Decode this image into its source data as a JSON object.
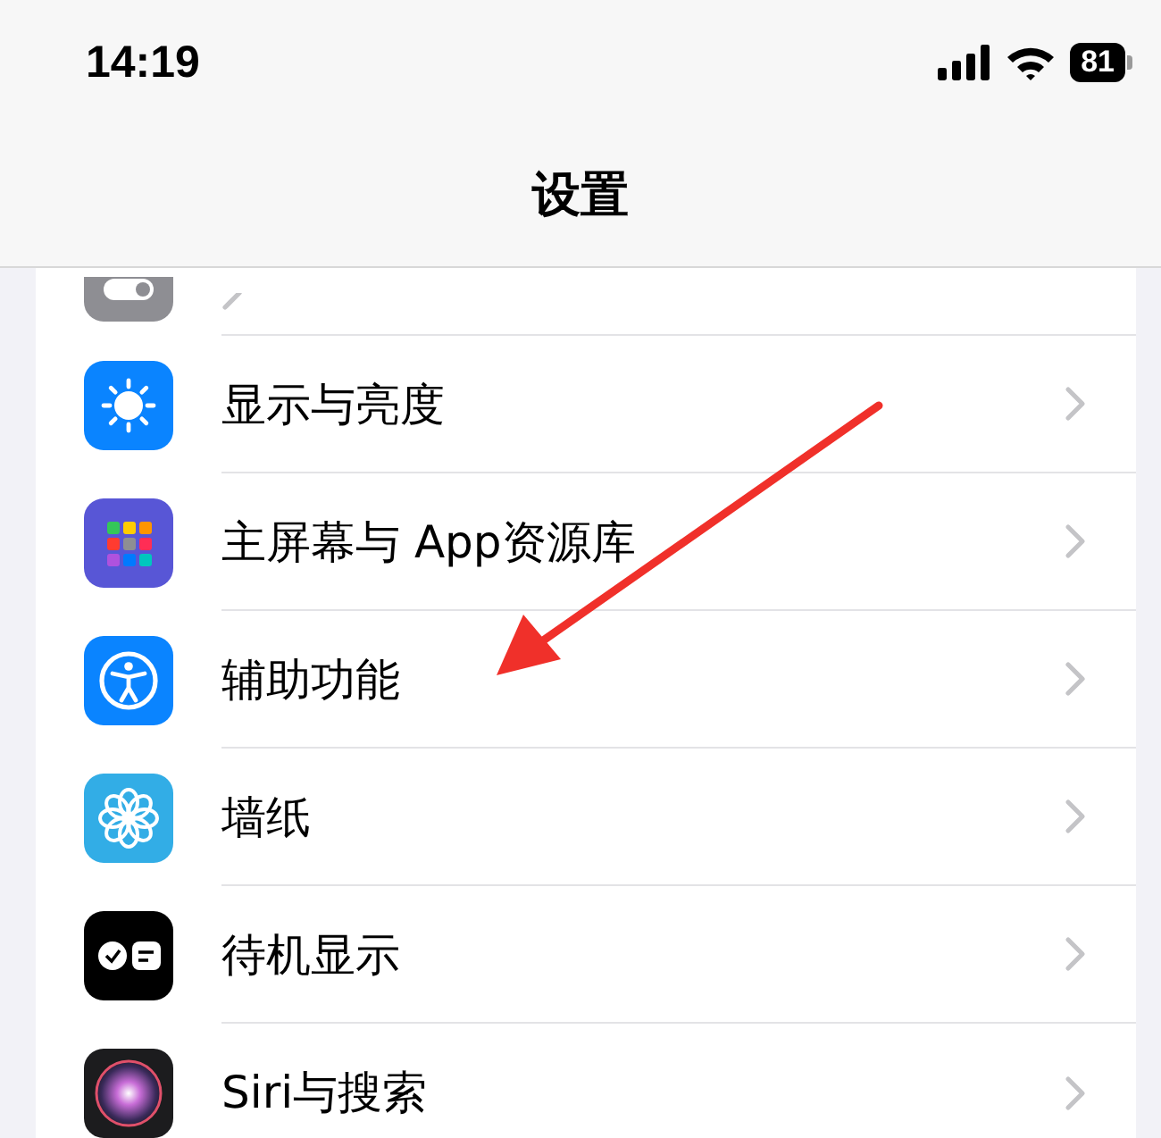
{
  "status_bar": {
    "time": "14:19",
    "battery": "81"
  },
  "nav": {
    "title": "设置"
  },
  "partial_item": {
    "kind": "toggles"
  },
  "items": [
    {
      "label": "显示与亮度",
      "kind": "sun"
    },
    {
      "label": "主屏幕与 App资源库",
      "kind": "grid"
    },
    {
      "label": "辅助功能",
      "kind": "accessibility"
    },
    {
      "label": "墙纸",
      "kind": "flower"
    },
    {
      "label": "待机显示",
      "kind": "standby"
    },
    {
      "label": "Siri与搜索",
      "kind": "siri"
    }
  ]
}
